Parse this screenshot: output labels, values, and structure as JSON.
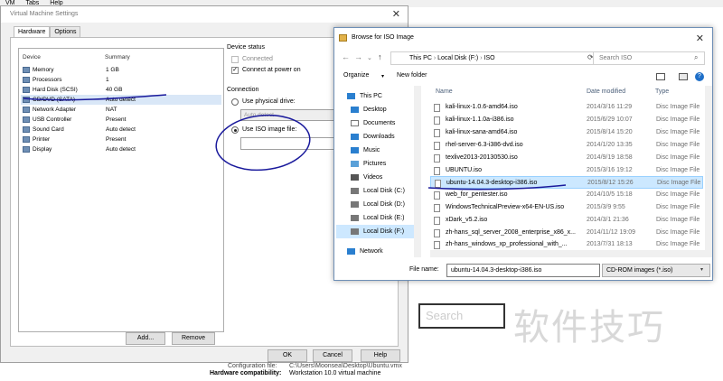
{
  "menubar": {
    "items": [
      "VM",
      "Tabs",
      "Help"
    ]
  },
  "vm_settings": {
    "title": "Virtual Machine Settings",
    "tabs": [
      "Hardware",
      "Options"
    ],
    "device_header": "Device",
    "summary_header": "Summary",
    "devices": [
      {
        "name": "Memory",
        "summary": "1 GB"
      },
      {
        "name": "Processors",
        "summary": "1"
      },
      {
        "name": "Hard Disk (SCSI)",
        "summary": "40 GB"
      },
      {
        "name": "CD/DVD (SATA)",
        "summary": "Auto detect"
      },
      {
        "name": "Network Adapter",
        "summary": "NAT"
      },
      {
        "name": "USB Controller",
        "summary": "Present"
      },
      {
        "name": "Sound Card",
        "summary": "Auto detect"
      },
      {
        "name": "Printer",
        "summary": "Present"
      },
      {
        "name": "Display",
        "summary": "Auto detect"
      }
    ],
    "device_status_label": "Device status",
    "connected_label": "Connected",
    "connect_power_label": "Connect at power on",
    "connection_label": "Connection",
    "physical_drive_label": "Use physical drive:",
    "physical_drive_value": "Auto detect",
    "iso_label": "Use ISO image file:",
    "add_label": "Add...",
    "remove_label": "Remove",
    "ok_label": "OK",
    "cancel_label": "Cancel",
    "help_label": "Help"
  },
  "browse": {
    "title": "Browse for ISO Image",
    "breadcrumb": [
      "This PC",
      "Local Disk (F:)",
      "ISO"
    ],
    "search_placeholder": "Search ISO",
    "organize_label": "Organize",
    "new_folder_label": "New folder",
    "nav_items": [
      "This PC",
      "Desktop",
      "Documents",
      "Downloads",
      "Music",
      "Pictures",
      "Videos",
      "Local Disk (C:)",
      "Local Disk (D:)",
      "Local Disk (E:)",
      "Local Disk (F:)",
      "Network"
    ],
    "columns": [
      "Name",
      "Date modified",
      "Type"
    ],
    "files": [
      {
        "name": "kali-linux-1.0.6-amd64.iso",
        "date": "2014/3/16 11:29",
        "type": "Disc Image File"
      },
      {
        "name": "kali-linux-1.1.0a-i386.iso",
        "date": "2015/6/29 10:07",
        "type": "Disc Image File"
      },
      {
        "name": "kali-linux-sana-amd64.iso",
        "date": "2015/8/14 15:20",
        "type": "Disc Image File"
      },
      {
        "name": "rhel-server-6.3-i386-dvd.iso",
        "date": "2014/1/20 13:35",
        "type": "Disc Image File"
      },
      {
        "name": "texlive2013-20130530.iso",
        "date": "2014/9/19 18:58",
        "type": "Disc Image File"
      },
      {
        "name": "UBUNTU.iso",
        "date": "2015/3/16 19:12",
        "type": "Disc Image File"
      },
      {
        "name": "ubuntu-14.04.3-desktop-i386.iso",
        "date": "2015/8/12 15:26",
        "type": "Disc Image File"
      },
      {
        "name": "web_for_pentester.iso",
        "date": "2014/10/5 15:18",
        "type": "Disc Image File"
      },
      {
        "name": "WindowsTechnicalPreview-x64-EN-US.iso",
        "date": "2015/3/9 9:55",
        "type": "Disc Image File"
      },
      {
        "name": "xDark_v5.2.iso",
        "date": "2014/3/1 21:36",
        "type": "Disc Image File"
      },
      {
        "name": "zh-hans_sql_server_2008_enterprise_x86_x...",
        "date": "2014/11/12 19:09",
        "type": "Disc Image File"
      },
      {
        "name": "zh-hans_windows_xp_professional_with_...",
        "date": "2013/7/31 18:13",
        "type": "Disc Image File"
      }
    ],
    "filename_label": "File name:",
    "filename_value": "ubuntu-14.04.3-desktop-i386.iso",
    "filetype_value": "CD-ROM images (*.iso)"
  },
  "background": {
    "search_text": "Search",
    "config_file_label": "Configuration file:",
    "config_file_value": "C:\\Users\\Moonsea\\Desktop\\Ubuntu.vmx",
    "hw_compat_label": "Hardware compatibility:",
    "hw_compat_value": "Workstation 10.0 virtual machine",
    "watermark": "软件技巧"
  },
  "colors": {
    "selection": "#cce8ff",
    "annotation_ink": "#1a1a9c",
    "accent": "#0078d7"
  }
}
